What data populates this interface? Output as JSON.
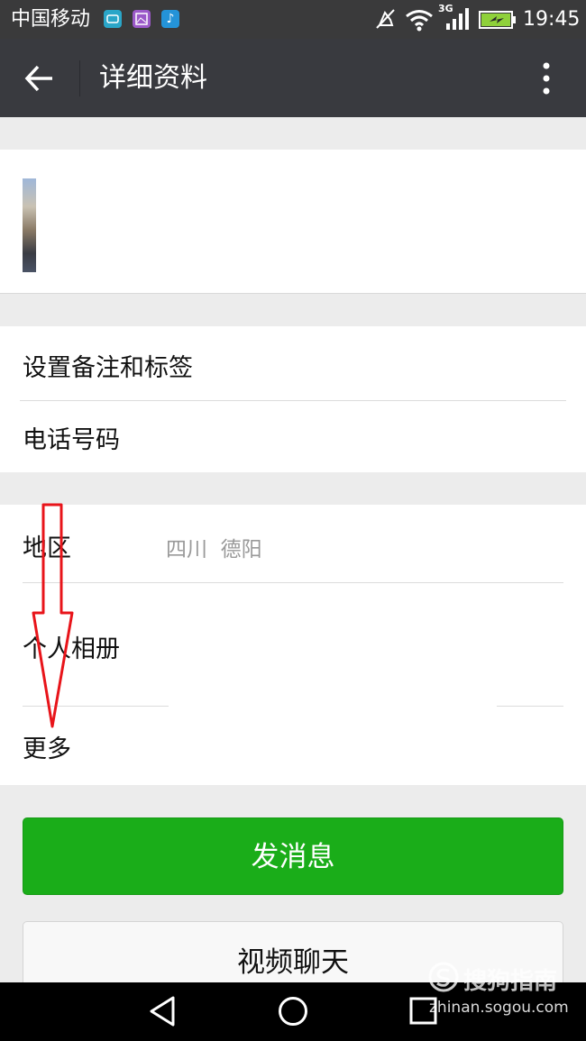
{
  "status_bar": {
    "carrier": "中国移动",
    "network": "3G",
    "time": "19:45",
    "battery_color": "#8fd13a"
  },
  "header": {
    "title": "详细资料"
  },
  "info_group": {
    "rows": [
      {
        "label": "设置备注和标签"
      },
      {
        "label": "电话号码"
      }
    ]
  },
  "detail_group": {
    "region_label": "地区",
    "region_value": "四川  德阳",
    "album_label": "个人相册",
    "more_label": "更多"
  },
  "actions": {
    "send_message": "发消息",
    "video_chat": "视频聊天",
    "primary_color": "#1aad19"
  },
  "watermark": {
    "brand": "搜狗指南",
    "url": "zhinan.sogou.com"
  },
  "icons": {
    "back": "arrow-left-icon",
    "menu": "more-vertical-icon",
    "sys_back": "triangle-back-icon",
    "sys_home": "circle-home-icon",
    "sys_recent": "square-recent-icon"
  }
}
